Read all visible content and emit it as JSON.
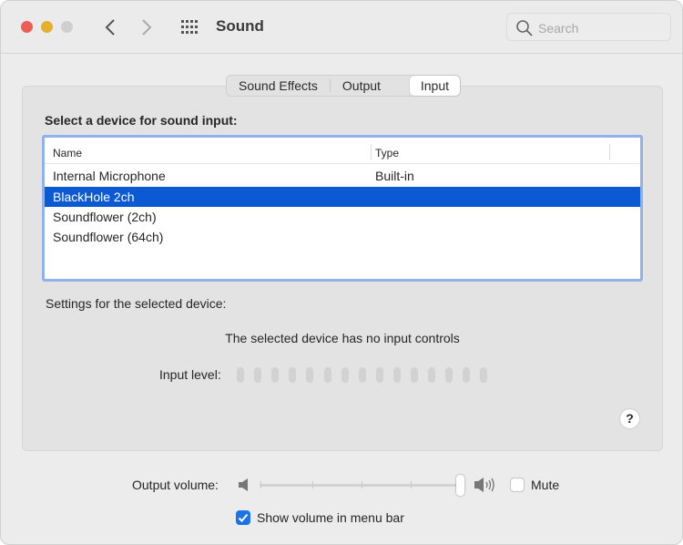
{
  "window": {
    "title": "Sound",
    "search_placeholder": "Search"
  },
  "tabs": [
    {
      "label": "Sound Effects"
    },
    {
      "label": "Output"
    },
    {
      "label": "Input",
      "active": true
    }
  ],
  "input": {
    "heading": "Select a device for sound input:",
    "columns": [
      "Name",
      "Type"
    ],
    "devices": [
      {
        "name": "Internal Microphone",
        "type": "Built-in"
      },
      {
        "name": "BlackHole 2ch",
        "type": "",
        "selected": true
      },
      {
        "name": "Soundflower (2ch)",
        "type": ""
      },
      {
        "name": "Soundflower (64ch)",
        "type": ""
      }
    ],
    "settings_label": "Settings for the selected device:",
    "no_controls": "The selected device has no input controls",
    "input_level_label": "Input level:",
    "input_level_segments": 15,
    "input_level_value": 0
  },
  "footer": {
    "output_volume_label": "Output volume:",
    "output_volume": 1.0,
    "mute_label": "Mute",
    "mute_checked": false,
    "show_volume_label": "Show volume in menu bar",
    "show_volume_checked": true
  },
  "colors": {
    "accent": "#0b5ad3",
    "close": "#ec5f57",
    "minimize": "#e5b02e",
    "zoom_disabled": "#cfcfcf"
  }
}
